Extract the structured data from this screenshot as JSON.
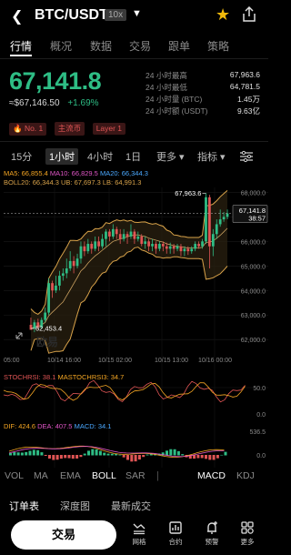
{
  "header": {
    "back_icon": "chevron-left-icon",
    "pair": "BTC/USDT",
    "leverage": "10x",
    "star_color": "#f0b90b"
  },
  "tabs": [
    "行情",
    "概况",
    "数据",
    "交易",
    "跟单",
    "策略"
  ],
  "ticker": {
    "last_price": "67,141.8",
    "fiat_value": "≈$67,146.50",
    "change": "+1.69%",
    "badges": [
      "🔥 No. 1",
      "主流币",
      "Layer 1"
    ]
  },
  "stats": [
    {
      "label": "24 小时最高",
      "value": "67,963.6"
    },
    {
      "label": "24 小时最低",
      "value": "64,781.5"
    },
    {
      "label": "24 小时量 (BTC)",
      "value": "1.45万"
    },
    {
      "label": "24 小时额 (USDT)",
      "value": "9.63亿"
    }
  ],
  "timeframes": {
    "items": [
      "15分",
      "1小时",
      "4小时",
      "1日",
      "更多 ▾",
      "指标 ▾"
    ],
    "active": "1小时"
  },
  "indicators": {
    "ma": {
      "ma5": "MA5: 66,855.4",
      "ma10": "MA10: 66,829.5",
      "ma20": "MA20: 66,344.3"
    },
    "boll": {
      "boll": "BOLL20: 66,344.3",
      "ub": "UB: 67,697.3",
      "lb": "LB: 64,991.3"
    },
    "stoch": {
      "stoch": "STOCHRSI: 38.1",
      "mastoch": "MASTOCHRSI3: 34.7"
    },
    "macd": {
      "dif": "DIF: 424.6",
      "dea": "DEA: 407.5",
      "macd": "MACD: 34.1"
    }
  },
  "chart_data": {
    "type": "candlestick",
    "y_ticks": [
      "68,000.0",
      "67,000.0",
      "66,000.0",
      "65,000.0",
      "64,000.0",
      "63,000.0",
      "62,000.0"
    ],
    "x_ticks": [
      "05:00",
      "10/14 16:00",
      "10/15 02:00",
      "10/15 13:00",
      "10/16 00:00"
    ],
    "annotations": {
      "high": "67,963.6",
      "low": "62,453.4"
    },
    "last_price": {
      "price": "67,141.8",
      "countdown": "38:57"
    },
    "stoch_ticks": [
      "50.0",
      "0.0"
    ],
    "macd_ticks": [
      "536.5",
      "0.0"
    ],
    "watermark": "欧易",
    "candles": [
      [
        62600,
        62400,
        62900,
        62450
      ],
      [
        62450,
        62700,
        62800,
        62300
      ],
      [
        62700,
        62500,
        62850,
        62420
      ],
      [
        62500,
        62800,
        62900,
        62420
      ],
      [
        62800,
        63100,
        63300,
        62700
      ],
      [
        63100,
        64300,
        64500,
        63000
      ],
      [
        64300,
        64000,
        64400,
        63700
      ],
      [
        64000,
        64200,
        64600,
        63900
      ],
      [
        64200,
        64600,
        64800,
        64000
      ],
      [
        64600,
        64700,
        64900,
        64400
      ],
      [
        64700,
        64900,
        65300,
        64500
      ],
      [
        64900,
        65200,
        65600,
        64800
      ],
      [
        65200,
        65000,
        65400,
        64700
      ],
      [
        65000,
        65300,
        65500,
        64900
      ],
      [
        65300,
        65800,
        66000,
        65100
      ],
      [
        65800,
        65600,
        66000,
        65400
      ],
      [
        65600,
        65900,
        66100,
        65500
      ],
      [
        65900,
        65700,
        66000,
        65500
      ],
      [
        65700,
        66000,
        66200,
        65600
      ],
      [
        66000,
        65800,
        66200,
        65600
      ],
      [
        65800,
        66100,
        66300,
        65700
      ],
      [
        66100,
        66400,
        66500,
        65800
      ],
      [
        66400,
        66200,
        66500,
        66000
      ],
      [
        66200,
        66500,
        66700,
        66100
      ],
      [
        66500,
        66300,
        66600,
        66100
      ],
      [
        66300,
        66100,
        66500,
        65900
      ],
      [
        66100,
        66300,
        66500,
        66000
      ],
      [
        66300,
        66200,
        66400,
        65900
      ],
      [
        66200,
        66400,
        66700,
        66100
      ],
      [
        66400,
        66100,
        66500,
        65900
      ],
      [
        66100,
        66200,
        66400,
        66000
      ],
      [
        66200,
        65900,
        66300,
        65800
      ],
      [
        65900,
        66000,
        66200,
        65700
      ],
      [
        66000,
        65800,
        66100,
        65600
      ],
      [
        65800,
        65900,
        66100,
        65600
      ],
      [
        65900,
        65700,
        66000,
        65500
      ],
      [
        65700,
        65900,
        66000,
        65600
      ],
      [
        65900,
        65800,
        66000,
        65600
      ],
      [
        65800,
        65700,
        65950,
        65500
      ],
      [
        65700,
        65800,
        65950,
        65500
      ],
      [
        65800,
        65700,
        65900,
        65500
      ],
      [
        65700,
        65800,
        65900,
        65600
      ],
      [
        65800,
        65600,
        65900,
        65400
      ],
      [
        65600,
        65700,
        65800,
        65400
      ],
      [
        65700,
        65600,
        65800,
        65450
      ],
      [
        65600,
        65700,
        65800,
        65500
      ],
      [
        65700,
        65900,
        66000,
        65600
      ],
      [
        65900,
        65800,
        66000,
        65700
      ],
      [
        65800,
        66000,
        66100,
        65700
      ],
      [
        66000,
        67800,
        67963.6,
        65900
      ],
      [
        67800,
        65800,
        67900,
        64900
      ],
      [
        65800,
        66300,
        66500,
        65400
      ],
      [
        66300,
        66700,
        66900,
        66100
      ],
      [
        66700,
        66900,
        67300,
        66600
      ],
      [
        66900,
        67000,
        67200,
        66800
      ],
      [
        67000,
        67141.8,
        67300,
        66900
      ]
    ]
  },
  "indicator_tabs": {
    "items": [
      "VOL",
      "MA",
      "EMA",
      "BOLL",
      "SAR",
      "MACD",
      "KDJ"
    ],
    "active": [
      "BOLL",
      "MACD"
    ]
  },
  "order_tabs": [
    "订单表",
    "深度图",
    "最新成交"
  ],
  "bottom_nav": {
    "trade": "交易",
    "items": [
      {
        "label": "网格",
        "icon": "grid-chart-icon"
      },
      {
        "label": "合约",
        "icon": "contract-icon"
      },
      {
        "label": "预警",
        "icon": "bell-plus-icon"
      },
      {
        "label": "更多",
        "icon": "apps-icon"
      }
    ]
  },
  "colors": {
    "up": "#2ebd85",
    "down": "#e05555",
    "ub": "#d9a34a",
    "ma": "#f5a623"
  }
}
